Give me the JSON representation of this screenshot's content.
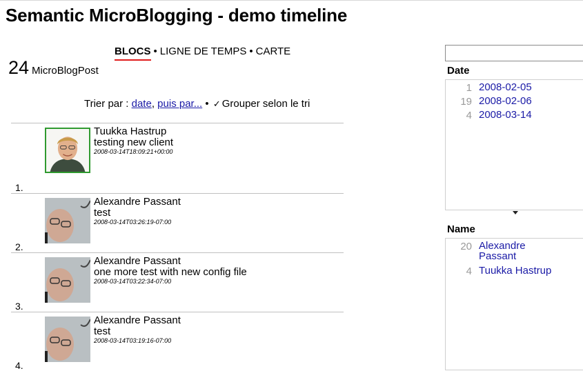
{
  "page": {
    "title": "Semantic MicroBlogging - demo timeline"
  },
  "views": [
    {
      "label": "BLOCS",
      "active": true
    },
    {
      "label": "LIGNE DE TEMPS",
      "active": false
    },
    {
      "label": "CARTE",
      "active": false
    }
  ],
  "nav_separator": "•",
  "summary": {
    "count": "24",
    "type": "MicroBlogPost"
  },
  "sort": {
    "prefix": "Trier par :",
    "primary": "date",
    "secondary": "puis par...",
    "separator": "•",
    "check_glyph": "✓",
    "group_label": "Grouper selon le tri"
  },
  "posts": [
    {
      "index": "1.",
      "author": "Tuukka Hastrup",
      "text": "testing new client",
      "timestamp": "2008-03-14T18:09:21+00:00",
      "avatar": "avatar-tuukka-icon"
    },
    {
      "index": "2.",
      "author": "Alexandre Passant",
      "text": "test",
      "timestamp": "2008-03-14T03:26:19-07:00",
      "avatar": "avatar-alexandre-icon"
    },
    {
      "index": "3.",
      "author": "Alexandre Passant",
      "text": "one more test with new config file",
      "timestamp": "2008-03-14T03:22:34-07:00",
      "avatar": "avatar-alexandre-icon"
    },
    {
      "index": "4.",
      "author": "Alexandre Passant",
      "text": "test",
      "timestamp": "2008-03-14T03:19:16-07:00",
      "avatar": "avatar-alexandre-icon"
    }
  ],
  "facets": {
    "search": {
      "value": "",
      "placeholder": ""
    },
    "date": {
      "title": "Date",
      "values": [
        {
          "count": "1",
          "label": "2008-02-05"
        },
        {
          "count": "19",
          "label": "2008-02-06"
        },
        {
          "count": "4",
          "label": "2008-03-14"
        }
      ]
    },
    "name": {
      "title": "Name",
      "values": [
        {
          "count": "20",
          "label": "Alexandre Passant"
        },
        {
          "count": "4",
          "label": "Tuukka Hastrup"
        }
      ]
    }
  },
  "colors": {
    "link": "#1a1aa6",
    "active_underline": "#e01b1b",
    "facet_count": "#999999",
    "avatar_border": "#2f9a2f"
  }
}
